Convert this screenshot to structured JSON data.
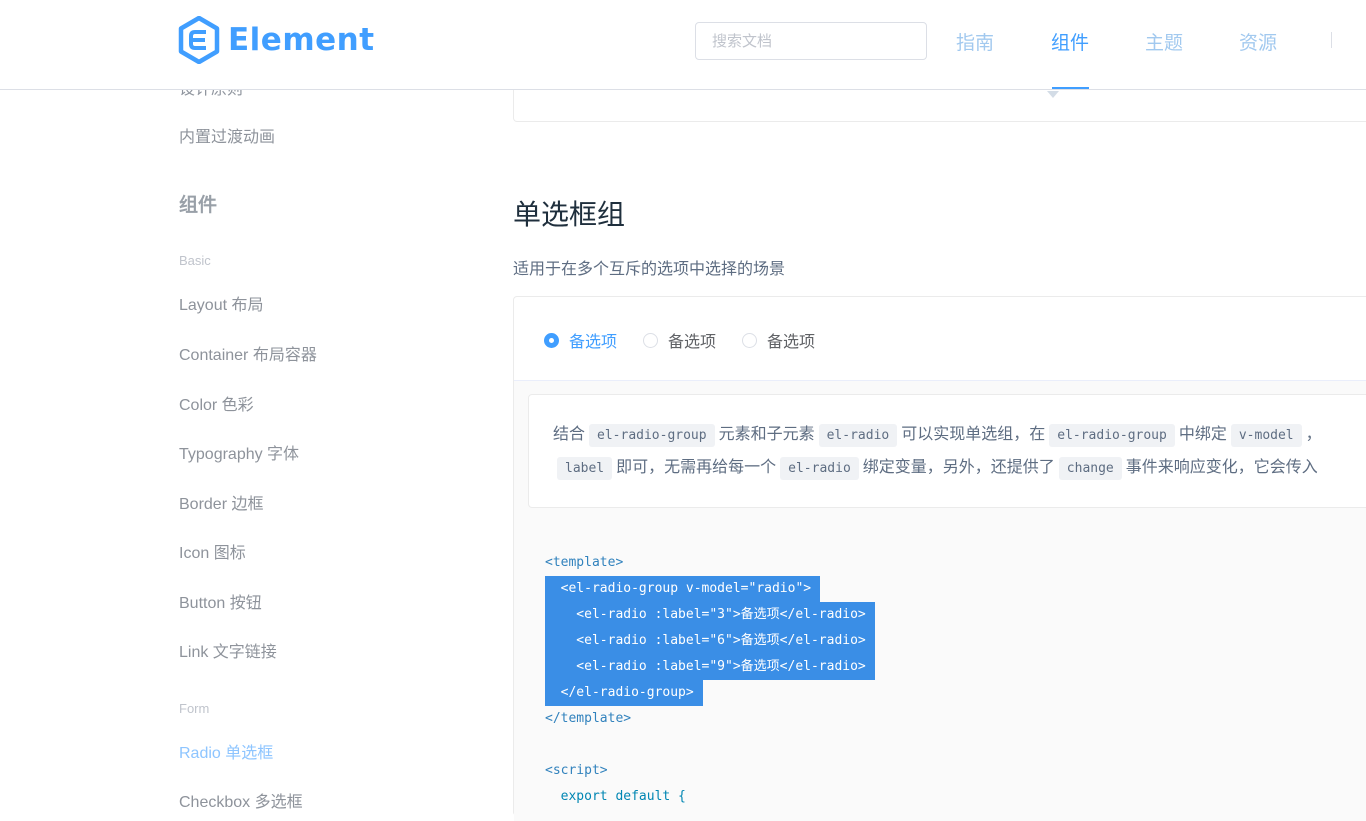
{
  "header": {
    "logo_text": "Element",
    "search_placeholder": "搜索文档",
    "nav": [
      {
        "label": "指南",
        "active": false
      },
      {
        "label": "组件",
        "active": true
      },
      {
        "label": "主题",
        "active": false
      },
      {
        "label": "资源",
        "active": false
      }
    ]
  },
  "sidebar": {
    "partial_item": "设计原则",
    "transition_item": "内置过渡动画",
    "section_title": "组件",
    "groups": [
      {
        "title": "Basic",
        "items": [
          "Layout 布局",
          "Container 布局容器",
          "Color 色彩",
          "Typography 字体",
          "Border 边框",
          "Icon 图标",
          "Button 按钮",
          "Link 文字链接"
        ]
      },
      {
        "title": "Form",
        "items": [
          "Radio 单选框",
          "Checkbox 多选框"
        ]
      }
    ],
    "active_item": "Radio 单选框"
  },
  "main": {
    "title": "单选框组",
    "description": "适用于在多个互斥的选项中选择的场景",
    "radios": [
      {
        "label": "备选项",
        "checked": true
      },
      {
        "label": "备选项",
        "checked": false
      },
      {
        "label": "备选项",
        "checked": false
      }
    ],
    "desc_line1": [
      "结合",
      "el-radio-group",
      "元素和子元素",
      "el-radio",
      "可以实现单选组，在",
      "el-radio-group",
      "中绑定",
      "v-model",
      "，"
    ],
    "desc_line2": [
      "label",
      "即可，无需再给每一个",
      "el-radio",
      "绑定变量，另外，还提供了",
      "change",
      "事件来响应变化，它会传入"
    ],
    "code_lines": [
      "<template>",
      "  <el-radio-group v-model=\"radio\">",
      "    <el-radio :label=\"3\">备选项</el-radio>",
      "    <el-radio :label=\"6\">备选项</el-radio>",
      "    <el-radio :label=\"9\">备选项</el-radio>",
      "  </el-radio-group>",
      "</template>",
      "",
      "<script>",
      "  export default {"
    ]
  },
  "colors": {
    "accent": "#409eff",
    "selection": "#3a8ee6"
  }
}
